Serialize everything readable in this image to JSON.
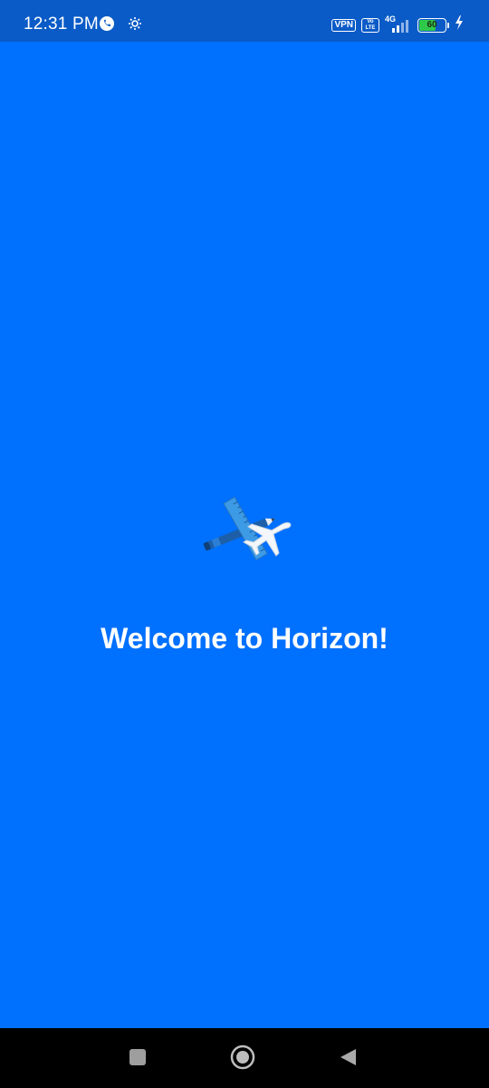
{
  "status_bar": {
    "time": "12:31 PM",
    "vpn_label": "VPN",
    "volte_label": "Vo LTE",
    "network_label": "4G",
    "battery_level": "60",
    "left_icons": [
      "messaging-app-icon",
      "settings-gear-icon"
    ],
    "right_icons": [
      "signal-strength-icon",
      "battery-icon",
      "charging-bolt-icon"
    ]
  },
  "main": {
    "logo_icon": "pencil-ruler-airplane-logo",
    "welcome_text": "Welcome to Horizon!",
    "background_color": "#0070FF"
  },
  "nav_bar": {
    "buttons": [
      "recents-square-icon",
      "home-circle-icon",
      "back-triangle-icon"
    ]
  }
}
